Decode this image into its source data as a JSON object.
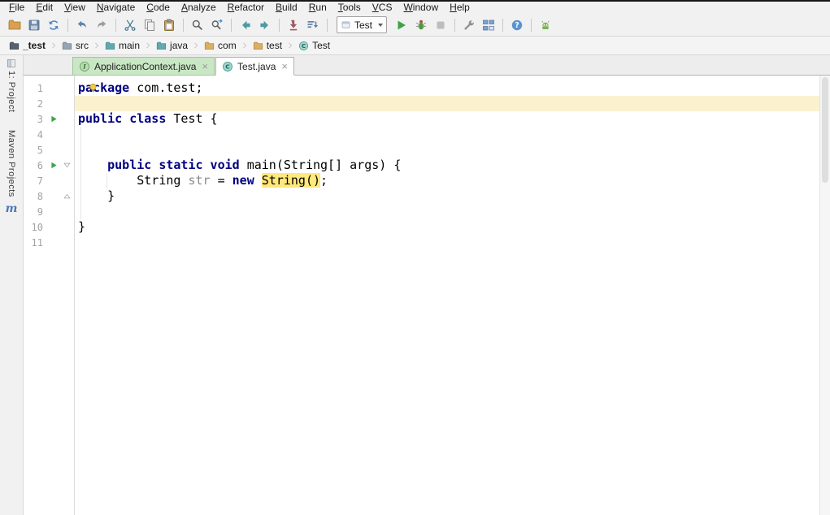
{
  "menu": {
    "items": [
      "File",
      "Edit",
      "View",
      "Navigate",
      "Code",
      "Analyze",
      "Refactor",
      "Build",
      "Run",
      "Tools",
      "VCS",
      "Window",
      "Help"
    ]
  },
  "toolbar": {
    "left_groups": [
      [
        "open-icon",
        "save-all-icon",
        "synchronize-icon"
      ],
      [
        "undo-icon",
        "redo-icon"
      ],
      [
        "cut-icon",
        "copy-icon",
        "paste-icon"
      ],
      [
        "find-icon",
        "replace-icon"
      ],
      [
        "back-icon",
        "forward-icon"
      ],
      [
        "update-project-icon",
        "make-project-icon"
      ]
    ],
    "run_config": {
      "label": "Test"
    },
    "run_icons": [
      "run-icon",
      "debug-icon",
      "stop-icon"
    ],
    "right_groups": [
      [
        "settings-icon",
        "project-structure-icon"
      ],
      [
        "help-icon"
      ],
      [
        "android-icon"
      ]
    ]
  },
  "breadcrumbs": {
    "items": [
      {
        "label": "_test",
        "icon": "module-folder-icon",
        "bold": true
      },
      {
        "label": "src",
        "icon": "folder-gray-icon"
      },
      {
        "label": "main",
        "icon": "source-folder-icon"
      },
      {
        "label": "java",
        "icon": "source-folder-icon"
      },
      {
        "label": "com",
        "icon": "package-folder-icon"
      },
      {
        "label": "test",
        "icon": "package-folder-icon"
      },
      {
        "label": "Test",
        "icon": "class-icon"
      }
    ]
  },
  "tabs": {
    "items": [
      {
        "label": "ApplicationContext.java",
        "icon": "interface-icon",
        "state": "green",
        "close": "×"
      },
      {
        "label": "Test.java",
        "icon": "class-icon",
        "state": "active",
        "close": "×"
      }
    ]
  },
  "stripe": {
    "project_label": "1: Project",
    "maven_label": "Maven Projects",
    "maven_icon_letter": "m"
  },
  "editor": {
    "lines": [
      {
        "num": 1,
        "bulb": true,
        "segments": [
          {
            "t": "package",
            "s": "kw"
          },
          {
            "t": " com.test;",
            "s": "p"
          }
        ]
      },
      {
        "num": 2,
        "caret": true,
        "segments": []
      },
      {
        "num": 3,
        "run": true,
        "segments": [
          {
            "t": "public class",
            "s": "kw"
          },
          {
            "t": " Test {",
            "s": "p"
          }
        ]
      },
      {
        "num": 4,
        "segments": []
      },
      {
        "num": 5,
        "segments": []
      },
      {
        "num": 6,
        "run": true,
        "fold": "open",
        "segments": [
          {
            "t": "    ",
            "s": "p"
          },
          {
            "t": "public static void",
            "s": "kw"
          },
          {
            "t": " main(String[] args) {",
            "s": "p"
          }
        ]
      },
      {
        "num": 7,
        "segments": [
          {
            "t": "        String ",
            "s": "p"
          },
          {
            "t": "str",
            "s": "unused"
          },
          {
            "t": " = ",
            "s": "p"
          },
          {
            "t": "new",
            "s": "kw"
          },
          {
            "t": " ",
            "s": "p"
          },
          {
            "t": "String()",
            "s": "hl"
          },
          {
            "t": ";",
            "s": "p"
          }
        ]
      },
      {
        "num": 8,
        "fold": "close",
        "segments": [
          {
            "t": "    }",
            "s": "p"
          }
        ]
      },
      {
        "num": 9,
        "segments": []
      },
      {
        "num": 10,
        "segments": [
          {
            "t": "}",
            "s": "p"
          }
        ]
      },
      {
        "num": 11,
        "segments": []
      }
    ]
  },
  "colors": {
    "keyword": "#000080",
    "usage_highlight": "#ffe87c",
    "caret_line": "#faf2cf",
    "tab_scope_green": "#c9e7c4",
    "run_green": "#3ba344",
    "maven_blue": "#4a78b8"
  }
}
